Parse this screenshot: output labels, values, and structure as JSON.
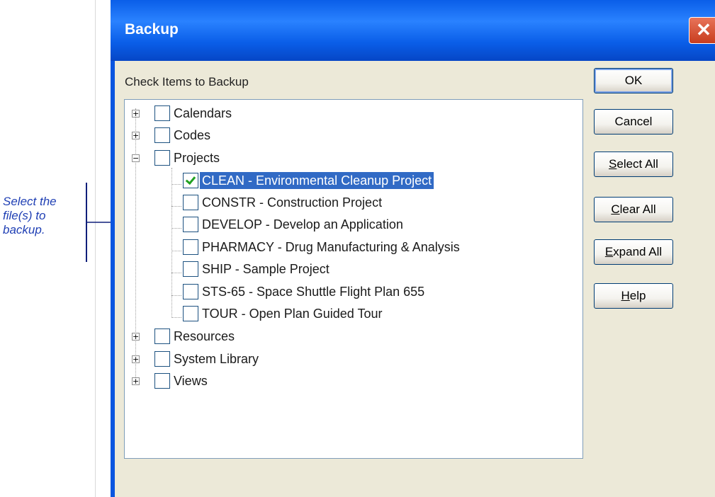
{
  "callout": {
    "text": "Select the file(s) to backup."
  },
  "dialog": {
    "title": "Backup",
    "label": "Check Items to Backup"
  },
  "tree": {
    "items": [
      {
        "label": "Calendars",
        "expander": "+",
        "checked": false
      },
      {
        "label": "Codes",
        "expander": "+",
        "checked": false
      },
      {
        "label": "Projects",
        "expander": "−",
        "checked": false,
        "children": [
          {
            "label": "CLEAN - Environmental Cleanup Project",
            "checked": true,
            "selected": true
          },
          {
            "label": "CONSTR - Construction Project",
            "checked": false
          },
          {
            "label": "DEVELOP - Develop an Application",
            "checked": false
          },
          {
            "label": "PHARMACY - Drug Manufacturing & Analysis",
            "checked": false
          },
          {
            "label": "SHIP - Sample Project",
            "checked": false
          },
          {
            "label": "STS-65 - Space Shuttle Flight Plan 655",
            "checked": false
          },
          {
            "label": "TOUR - Open Plan Guided Tour",
            "checked": false
          }
        ]
      },
      {
        "label": "Resources",
        "expander": "+",
        "checked": false
      },
      {
        "label": "System Library",
        "expander": "+",
        "checked": false
      },
      {
        "label": "Views",
        "expander": "+",
        "checked": false
      }
    ]
  },
  "buttons": {
    "ok": "OK",
    "cancel": "Cancel",
    "select_all": {
      "access_key": "S",
      "rest": "elect All"
    },
    "clear_all": {
      "access_key": "C",
      "rest": "lear All"
    },
    "expand_all": {
      "access_key": "E",
      "rest": "xpand All"
    },
    "help": {
      "access_key": "H",
      "rest": "elp"
    }
  },
  "colors": {
    "title_bar": "#0a5ee8",
    "selection": "#316ac5",
    "check": "#21a121",
    "callout_text": "#1f3fb4"
  },
  "icons": {
    "close": "close-icon",
    "check": "checkmark-icon"
  }
}
